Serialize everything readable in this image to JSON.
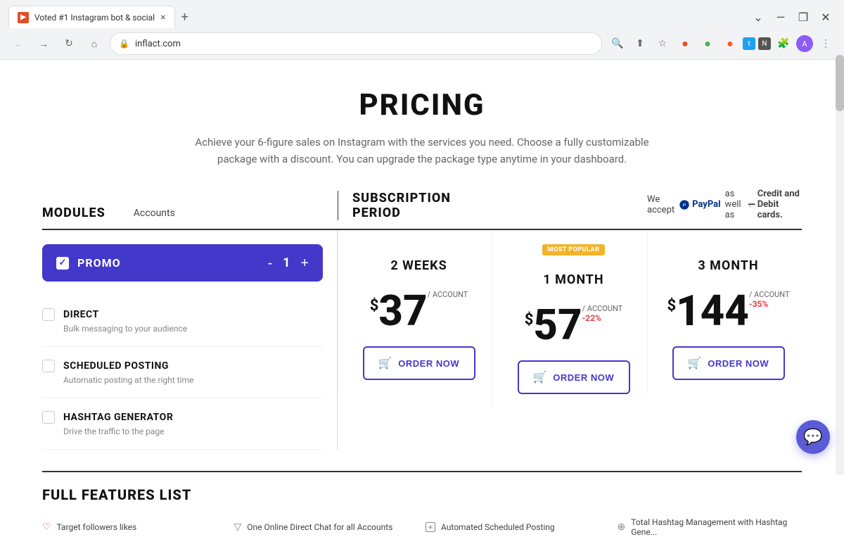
{
  "browser": {
    "tab_title": "Voted #1 Instagram bot & social",
    "tab_close": "×",
    "new_tab": "+",
    "url": "inflact.com",
    "window_minimize": "—",
    "window_maximize": "❐",
    "window_close": "✕",
    "chevron_down": "⌄",
    "back_icon": "←",
    "forward_icon": "→",
    "refresh_icon": "↻",
    "home_icon": "⌂"
  },
  "page": {
    "title": "PRICING",
    "subtitle": "Achieve your 6-figure sales on Instagram with the services you need. Choose a fully customizable package with a discount. You can upgrade the package type anytime in your dashboard."
  },
  "table": {
    "modules_label": "MODULES",
    "accounts_label": "Accounts",
    "subscription_label": "SUBSCRIPTION PERIOD",
    "payment_text": "We accept",
    "paypal_label": "PayPal",
    "payment_also": "as well as",
    "credit_label": "Credit and Debit cards."
  },
  "promo": {
    "label": "PROMO",
    "quantity": "1",
    "minus": "-",
    "plus": "+"
  },
  "modules": [
    {
      "name": "DIRECT",
      "desc": "Bulk messaging to your audience"
    },
    {
      "name": "SCHEDULED POSTING",
      "desc": "Automatic posting at the right time"
    },
    {
      "name": "HASHTAG GENERATOR",
      "desc": "Drive the traffic to the page"
    }
  ],
  "plans": [
    {
      "name": "2 WEEKS",
      "most_popular": false,
      "currency": "$",
      "price": "37",
      "per_account": "/ ACCOUNT",
      "discount": "",
      "order_label": "ORDER NOW"
    },
    {
      "name": "1 MONTH",
      "most_popular": true,
      "most_popular_label": "MOST POPULAR",
      "currency": "$",
      "price": "57",
      "per_account": "/ ACCOUNT",
      "discount": "-22%",
      "order_label": "ORDER NOW"
    },
    {
      "name": "3 MONTH",
      "most_popular": false,
      "currency": "$",
      "price": "144",
      "per_account": "/ ACCOUNT",
      "discount": "-35%",
      "order_label": "ORDER NOW"
    }
  ],
  "full_features": {
    "title": "FULL FEATURES LIST",
    "items": [
      {
        "icon": "♡",
        "text": "Target followers likes"
      },
      {
        "icon": "▽",
        "text": "One Online Direct Chat for all Accounts"
      },
      {
        "icon": "+",
        "text": "Automated Scheduled Posting"
      },
      {
        "icon": "⊕",
        "text": "Total Hashtag Management with Hashtag Gene..."
      }
    ]
  }
}
